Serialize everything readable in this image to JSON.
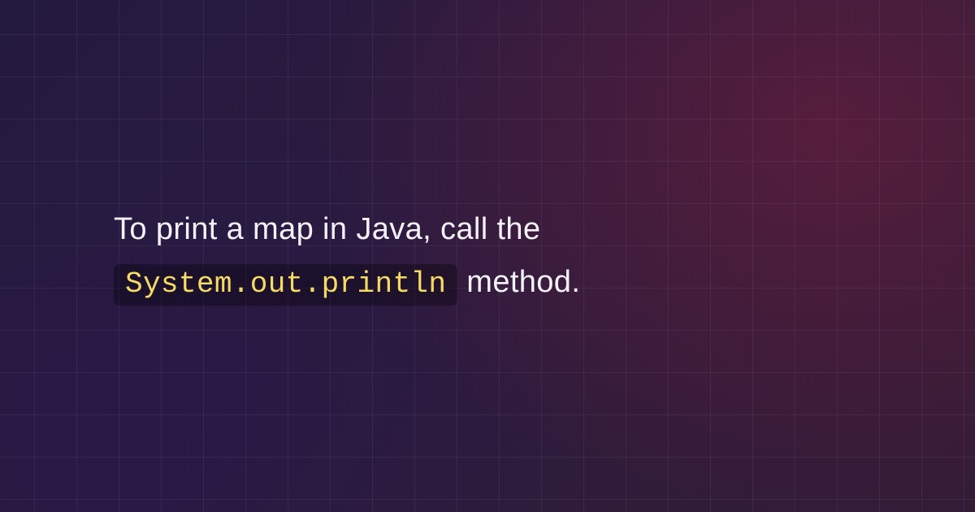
{
  "text": {
    "before": "To print a map in Java, call the ",
    "code": "System.out.println",
    "after": " method."
  }
}
